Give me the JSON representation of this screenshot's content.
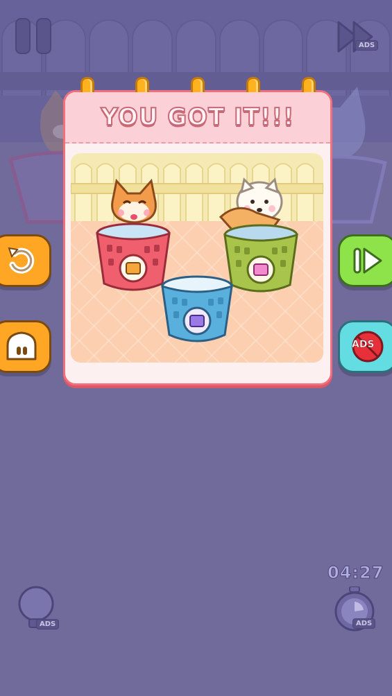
{
  "popup": {
    "title": "YOU GOT IT!!!"
  },
  "hud": {
    "timer": "04:27",
    "skip_ads_tag": "ADS",
    "hint_ads_tag": "ADS",
    "time_ads_tag": "ADS"
  },
  "side_buttons": {
    "no_ads_label": "ADS"
  },
  "colors": {
    "accent_orange": "#ffa724",
    "accent_green": "#8fe34a",
    "accent_cyan": "#63dde2",
    "card_border": "#f26f7d",
    "basket_red": "#ef5f6d",
    "basket_green": "#a8c44a",
    "basket_blue": "#5ab0dc"
  },
  "icons": {
    "pause": "pause-icon",
    "skip": "fast-forward-icon",
    "retry": "retry-icon",
    "home": "home-icon",
    "next": "next-icon",
    "no_ads": "no-ads-icon",
    "hint": "lightbulb-icon",
    "time": "stopwatch-icon"
  }
}
